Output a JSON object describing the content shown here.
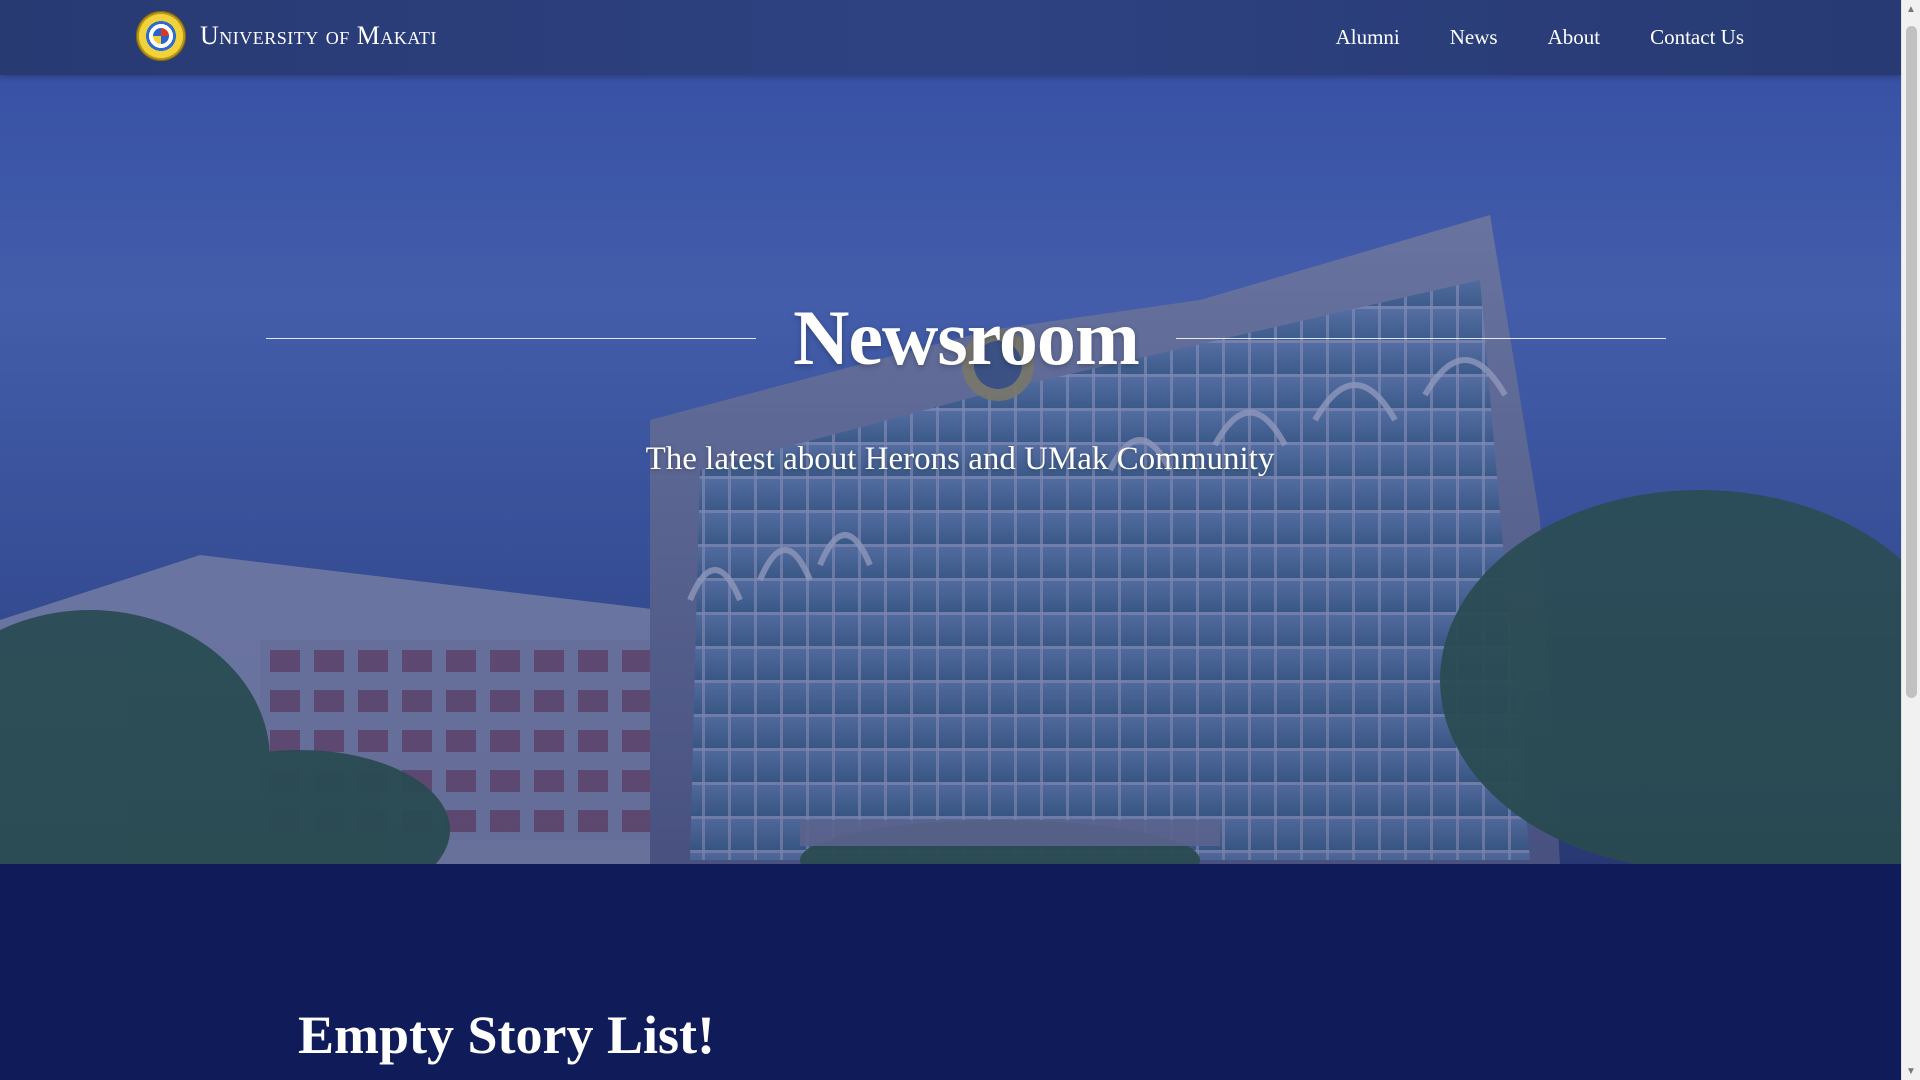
{
  "navbar": {
    "brand_name": "University of Makati",
    "logo_icon": "university-seal-icon",
    "links": [
      {
        "label": "Alumni"
      },
      {
        "label": "News"
      },
      {
        "label": "About"
      },
      {
        "label": "Contact Us"
      }
    ]
  },
  "hero": {
    "title": "Newsroom",
    "subtitle": "The latest about Herons and UMak Community",
    "background": "university-admin-building-photo"
  },
  "content": {
    "empty_message": "Empty Story List!"
  },
  "colors": {
    "navbar": "#2e4282",
    "page_background": "#0f1c59",
    "hero_tint": "#4866b0",
    "text": "#ffffff"
  },
  "scrollbar": {
    "up_icon": "scroll-up-arrow-icon",
    "down_icon": "scroll-down-arrow-icon"
  }
}
